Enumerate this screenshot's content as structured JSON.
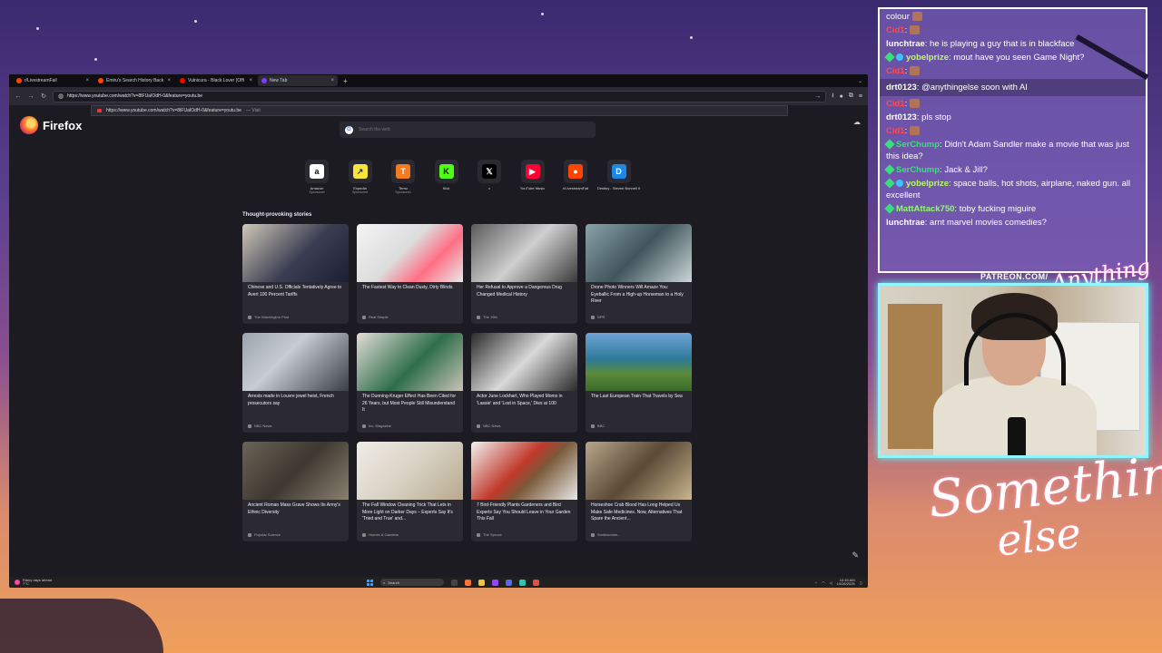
{
  "browser": {
    "tabs": [
      {
        "label": "r/LivestreamFail",
        "color": "#ff4500",
        "active": false
      },
      {
        "label": "Emiru's Search History Back in",
        "color": "#ff4500",
        "active": false
      },
      {
        "label": "Vulnicura - Black Lover (Offi",
        "color": "#ff0000",
        "active": false
      },
      {
        "label": "New Tab",
        "color": "#7d3cff",
        "active": true
      }
    ],
    "url_value": "https://www.youtube.com/watch?v=8tFUaIOdH-0&feature=youtu.be",
    "suggestion": {
      "url": "https://www.youtube.com/watch?v=8tFUaIOdH-0&feature=youtu.be",
      "action": "— Visit"
    }
  },
  "newtab": {
    "brand": "Firefox",
    "search_placeholder": "Search the web",
    "shortcuts": [
      {
        "name": "Amazon",
        "sponsored": "Sponsored",
        "glyph": "a",
        "bg": "#ffffff",
        "fg": "#111111"
      },
      {
        "name": "Expedia",
        "sponsored": "Sponsored",
        "glyph": "↗",
        "bg": "#f9e43a",
        "fg": "#1c2a5a"
      },
      {
        "name": "Temu",
        "sponsored": "Sponsored",
        "glyph": "T",
        "bg": "#f47b1f",
        "fg": "#ffffff"
      },
      {
        "name": "Kick",
        "sponsored": "",
        "glyph": "K",
        "bg": "#53fc18",
        "fg": "#000000"
      },
      {
        "name": "x",
        "sponsored": "",
        "glyph": "𝕏",
        "bg": "#000000",
        "fg": "#ffffff"
      },
      {
        "name": "YouTube Music",
        "sponsored": "",
        "glyph": "▶",
        "bg": "#ff0033",
        "fg": "#ffffff"
      },
      {
        "name": "r/LivestreamFail",
        "sponsored": "",
        "glyph": "●",
        "bg": "#ff4500",
        "fg": "#ffffff"
      },
      {
        "name": "Destiny - Steven Bonnell II",
        "sponsored": "",
        "glyph": "D",
        "bg": "#1e88e5",
        "fg": "#ffffff"
      }
    ],
    "stories_title": "Thought-provoking stories",
    "stories": [
      {
        "title": "Chinese and U.S. Officials Tentatively Agree to Avert 100 Percent Tariffs",
        "source": "The Washington Post",
        "img": "linear-gradient(135deg,#cfc7b8,#3b3e52 55%,#1b1f33)"
      },
      {
        "title": "The Fastest Way to Clean Dusty, Dirty Blinds",
        "source": "Real Simple",
        "img": "linear-gradient(135deg,#f4f4f4,#dcdcdc 45%,#ff6f84 70%,#e8e8e8)"
      },
      {
        "title": "Her Refusal to Approve a Dangerous Drug Changed Medical History",
        "source": "The 19th",
        "img": "linear-gradient(135deg,#5b5b5b,#cfcfcf 50%,#3a3a3a)"
      },
      {
        "title": "Drone Photo Winners Will Amaze You: Eyeballic From a High-up Horseman to a Holy River",
        "source": "NPR",
        "img": "linear-gradient(135deg,#8aa3a8,#40555c 50%,#cbd6d6)"
      },
      {
        "title": "Arrests made in Louvre jewel heist, French prosecutors say",
        "source": "NBC News",
        "img": "linear-gradient(135deg,#9aa3ad,#c7ccd1 40%,#3a3f46)"
      },
      {
        "title": "The Dunning-Kruger Effect Has Been Cited for 26 Years, but Most People Still Misunderstand It",
        "source": "Inc. Magazine",
        "img": "linear-gradient(135deg,#e2ddd6,#2e6e4a 55%,#c9c2b8)"
      },
      {
        "title": "Actor June Lockhart, Who Played Moms in 'Lassie' and 'Lost in Space,' Dies at 100",
        "source": "NBC News",
        "img": "linear-gradient(135deg,#2a2a2a,#d9d9d9 50%,#2a2a2a)"
      },
      {
        "title": "The Last European Train That Travels by Sea",
        "source": "BBC",
        "img": "linear-gradient(180deg,#6fa3d6,#2e7a9a 45%,#5a8a3a 70%,#3c6a2a)"
      },
      {
        "title": "Ancient Roman Mass Grave Shows Its Army's Ethnic Diversity",
        "source": "Popular Science",
        "img": "linear-gradient(135deg,#6b6357,#3d3830 50%,#8a8070)"
      },
      {
        "title": "The Fall Window Cleaning Trick That Lets in More Light on Darker Days – Experts Say It's 'Tried and True' and...",
        "source": "Homes & Gardens",
        "img": "linear-gradient(135deg,#f0ede6,#d8d2c4 50%,#b8a98c)"
      },
      {
        "title": "7 Bird-Friendly Plants Gardeners and Bird Experts Say You Should Leave in Your Garden This Fall",
        "source": "The Spruce",
        "img": "linear-gradient(135deg,#f2f2f2,#c0392b 45%,#7a5a3a 60%,#e8e8e8)"
      },
      {
        "title": "Horseshoe Crab Blood Has Long Helped Us Make Safe Medicines. Now, Alternatives That Spare the Ancient...",
        "source": "Smithsonian...",
        "img": "linear-gradient(135deg,#b7a68a,#5a4a36 50%,#c9b48e)"
      }
    ],
    "stories_row4": [
      "linear-gradient(90deg,#d0b020,#2f8a2f)",
      "linear-gradient(90deg,#8a6a40,#c9a060)",
      "linear-gradient(90deg,#3a4a7a,#e8b890,#d0d0d0)",
      "linear-gradient(90deg,#3a2a1a,#c09060)"
    ]
  },
  "taskbar": {
    "weather_line1": "Rainy days ahead",
    "weather_line2": "7°C",
    "search_label": "Search",
    "time": "10:49 AM",
    "date": "10/26/2025"
  },
  "chat": {
    "messages": [
      {
        "user": "",
        "text": "colour",
        "color": "#ffffff",
        "badge": "",
        "emote": true
      },
      {
        "user": "Cid1",
        "text": ":",
        "color": "#ff4b4b",
        "badge": "",
        "emote": true
      },
      {
        "user": "lunchtrae",
        "text": ": he is playing a guy that is in blackface",
        "color": "#ffffff",
        "badge": "",
        "emote": false
      },
      {
        "user": "yobelprize",
        "text": ": mout have you seen Game Night?",
        "color": "#b8ff5a",
        "badge": "both",
        "emote": false
      },
      {
        "user": "Cid1",
        "text": ":",
        "color": "#ff4b4b",
        "badge": "",
        "emote": true
      },
      {
        "user": "drt0123",
        "text": ": @anythingelse soon with AI",
        "color": "#ffffff",
        "badge": "",
        "emote": false,
        "highlight": true
      },
      {
        "user": "Cid1",
        "text": ":",
        "color": "#ff4b4b",
        "badge": "",
        "emote": true
      },
      {
        "user": "drt0123",
        "text": ": pls stop",
        "color": "#ffffff",
        "badge": "",
        "emote": false
      },
      {
        "user": "Cid1",
        "text": ":",
        "color": "#ff4b4b",
        "badge": "",
        "emote": true
      },
      {
        "user": "SerChump",
        "text": ": Didn't Adam Sandler make a movie that was just this idea?",
        "color": "#39e07a",
        "badge": "sub",
        "emote": false
      },
      {
        "user": "SerChump",
        "text": ": Jack & Jill?",
        "color": "#39e07a",
        "badge": "sub",
        "emote": false
      },
      {
        "user": "yobelprize",
        "text": ": space balls, hot shots, airplane, naked gun. all excellent",
        "color": "#b8ff5a",
        "badge": "both",
        "emote": false
      },
      {
        "user": "MattAttack750",
        "text": ": toby fucking miguire",
        "color": "#8cff6a",
        "badge": "sub",
        "emote": false
      },
      {
        "user": "lunchtrae",
        "text": ": arnt marvel movies comedies?",
        "color": "#ffffff",
        "badge": "",
        "emote": false
      }
    ]
  },
  "overlay": {
    "patreon": "PATREON.COM/",
    "logo_top": "Anything Else",
    "logo_bottom_1": "Something",
    "logo_bottom_2": "else"
  }
}
